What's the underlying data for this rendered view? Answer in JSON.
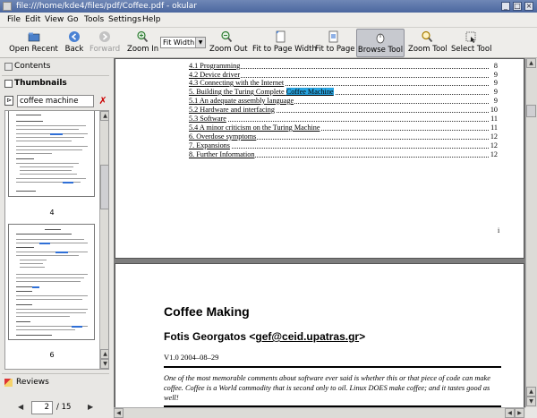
{
  "window": {
    "title": "file:///home/kde4/files/pdf/Coffee.pdf - okular"
  },
  "menu": {
    "items": [
      "File",
      "Edit",
      "View",
      "Go",
      "Tools",
      "Settings",
      "Help"
    ]
  },
  "toolbar": {
    "open_recent": "Open Recent",
    "back": "Back",
    "forward": "Forward",
    "zoom_in": "Zoom In",
    "zoom_value": "Fit Width",
    "zoom_out": "Zoom Out",
    "fit_width": "Fit to Page Width",
    "fit_page": "Fit to Page",
    "browse": "Browse Tool",
    "zoom_tool": "Zoom Tool",
    "select": "Select Tool"
  },
  "sidebar": {
    "contents": "Contents",
    "thumbnails": "Thumbnails",
    "search_value": "coffee machine",
    "thumb_labels": [
      "4",
      "6"
    ],
    "reviews": "Reviews"
  },
  "pager": {
    "current": "2",
    "total": "/ 15"
  },
  "toc": [
    {
      "text": "4.1 Programming",
      "page": "8"
    },
    {
      "text": "4.2 Device driver",
      "page": "9"
    },
    {
      "text": "4.3 Connecting with the Internet",
      "page": "9"
    },
    {
      "text_before": "5. Building the Turing Complete ",
      "highlight": "Coffee Machine",
      "page": "9"
    },
    {
      "text": "5.1 An adequate assembly language",
      "page": "9"
    },
    {
      "text": "5.2 Hardware and interfacing",
      "page": "10"
    },
    {
      "text": "5.3 Software",
      "page": "11"
    },
    {
      "text": "5.4 A minor criticism on the Turing Machine",
      "page": "11"
    },
    {
      "text": "6. Overdose symptoms",
      "page": "12"
    },
    {
      "text": "7. Expansions",
      "page": "12"
    },
    {
      "text": "8. Further Information",
      "page": "12"
    }
  ],
  "page_footer": "i",
  "doc": {
    "title": "Coffee Making",
    "author_prefix": "Fotis Georgatos <",
    "author_email": "gef@ceid.upatras.gr",
    "author_suffix": ">",
    "version": "V1.0 2004–08–29",
    "abstract": "One of the most memorable comments about software ever said is whether this or that piece of code can make coffee. Coffee is a World commodity that is second only to oil. Linux DOES make coffee; and it tastes good as well!"
  }
}
